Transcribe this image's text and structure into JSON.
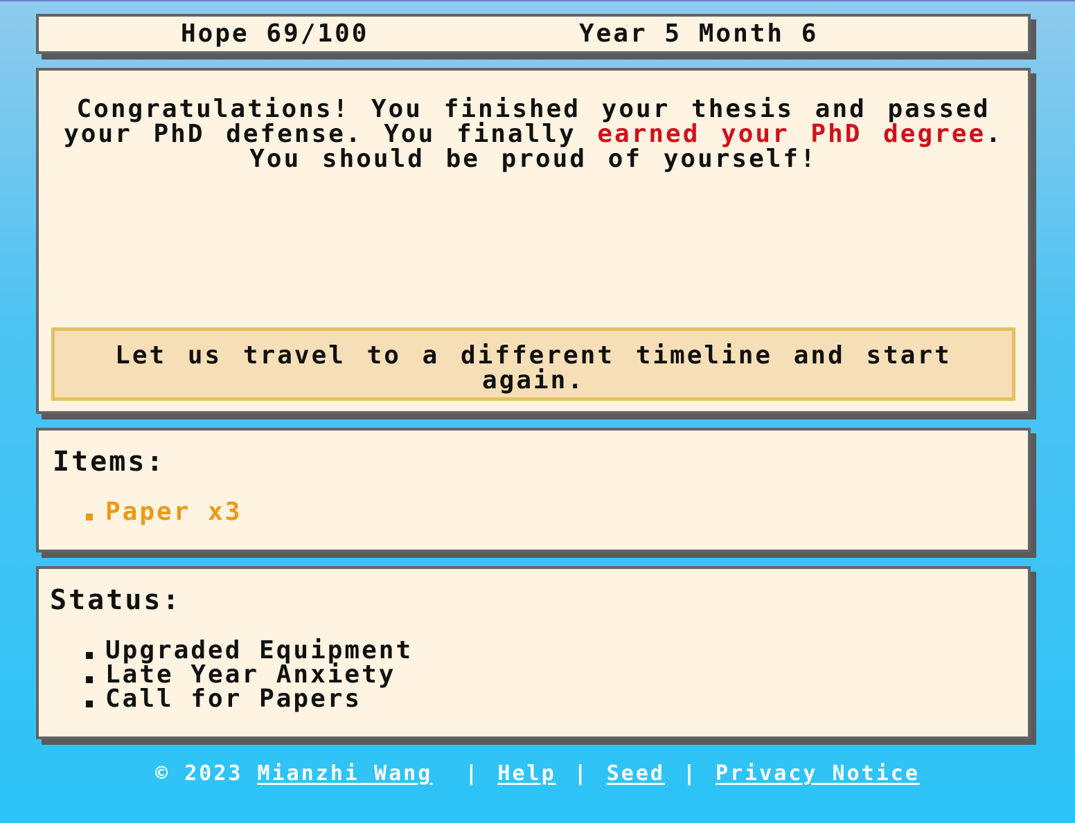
{
  "header": {
    "hope_label": "Hope",
    "hope_value": "69/100",
    "date_text": "Year 5 Month 6"
  },
  "story": {
    "text_before": "Congratulations! You finished your thesis and passed your PhD defense. You finally ",
    "highlight": "earned your PhD degree",
    "text_after": ". You should be proud of yourself!",
    "highlight_color": "#d0101c"
  },
  "choices": [
    {
      "label": "Let us travel to a different timeline and start again."
    }
  ],
  "items": {
    "title": "Items:",
    "list": [
      "Paper x3"
    ],
    "item_color": "#ec9a12"
  },
  "status": {
    "title": "Status:",
    "list": [
      "Upgraded Equipment",
      "Late Year Anxiety",
      "Call for Papers"
    ]
  },
  "footer": {
    "copyright": "© 2023",
    "author_link": "Mianzhi Wang",
    "separator": "|",
    "help_link": "Help",
    "seed_link": "Seed",
    "privacy_link": "Privacy Notice"
  }
}
